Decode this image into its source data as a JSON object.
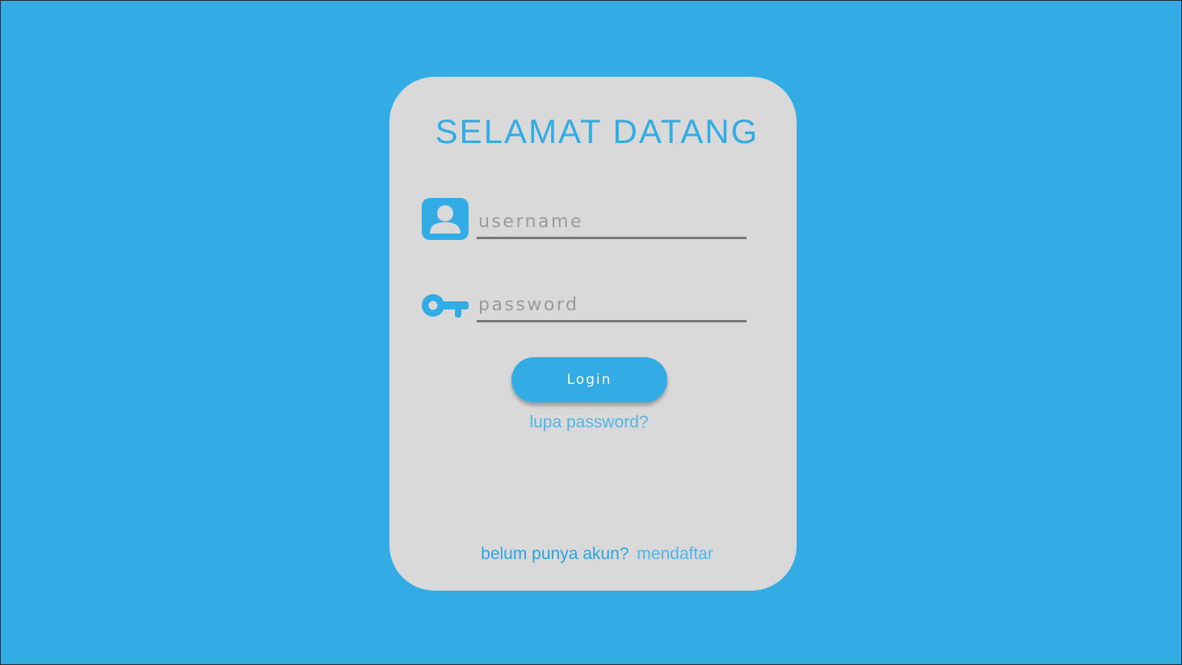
{
  "colors": {
    "background": "#33ace6",
    "card": "#d9d9d9",
    "accent": "#33ace6",
    "link": "#52b5ea",
    "underline": "#777777"
  },
  "login_card": {
    "title": "SELAMAT DATANG",
    "username_field": {
      "icon": "user-icon",
      "value": "",
      "placeholder": "username"
    },
    "password_field": {
      "icon": "key-icon",
      "value": "",
      "placeholder": "password"
    },
    "login_button_label": "Login",
    "forgot_password_link": "lupa password?",
    "signup": {
      "question": "belum punya akun?",
      "link": "mendaftar"
    }
  }
}
